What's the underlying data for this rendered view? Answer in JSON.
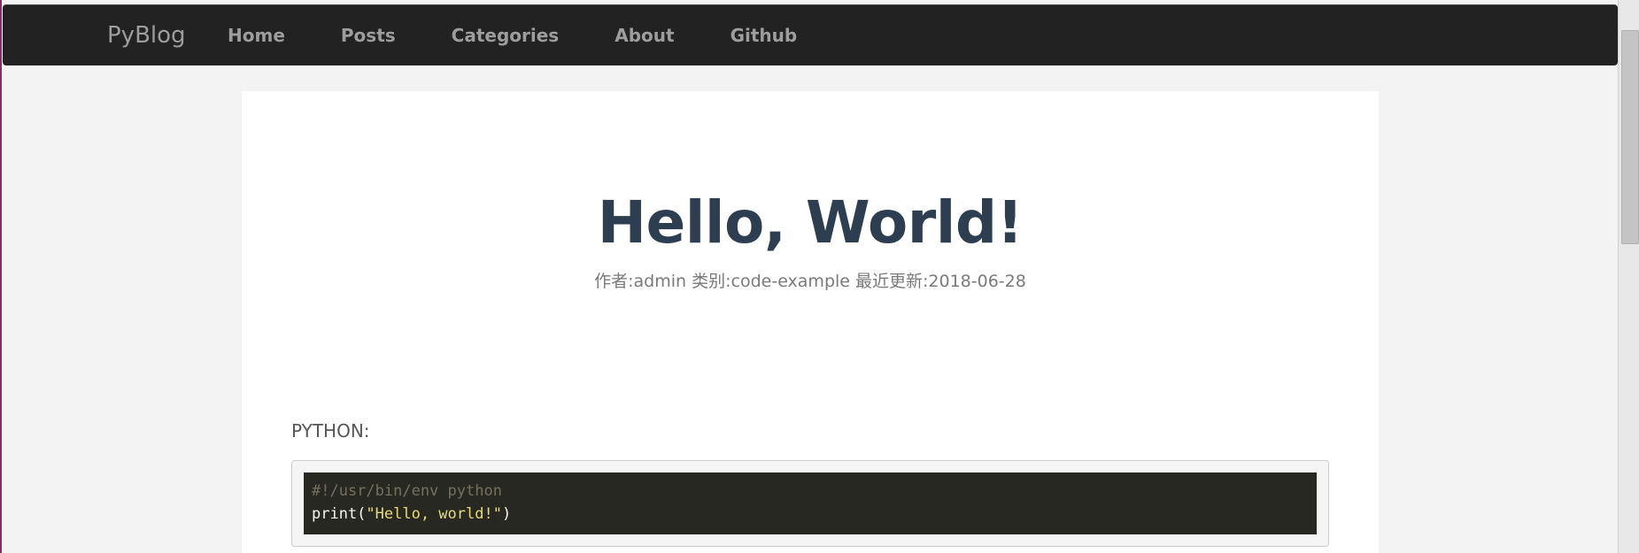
{
  "navbar": {
    "brand": "PyBlog",
    "links": [
      {
        "label": "Home"
      },
      {
        "label": "Posts"
      },
      {
        "label": "Categories"
      },
      {
        "label": "About"
      },
      {
        "label": "Github"
      }
    ]
  },
  "post": {
    "title": "Hello, World!",
    "meta": "作者:admin 类别:code-example 最近更新:2018-06-28",
    "language_label": "PYTHON:",
    "code": {
      "line1_comment": "#!/usr/bin/env python",
      "line2_func": "print(",
      "line2_string": "\"Hello, world!\"",
      "line2_close": ")"
    }
  },
  "colors": {
    "navbar_bg": "#222222",
    "nav_text": "#9d9d9d",
    "title": "#2c3e50",
    "code_bg": "#272822",
    "code_comment": "#75715e",
    "code_string": "#e6db74"
  }
}
